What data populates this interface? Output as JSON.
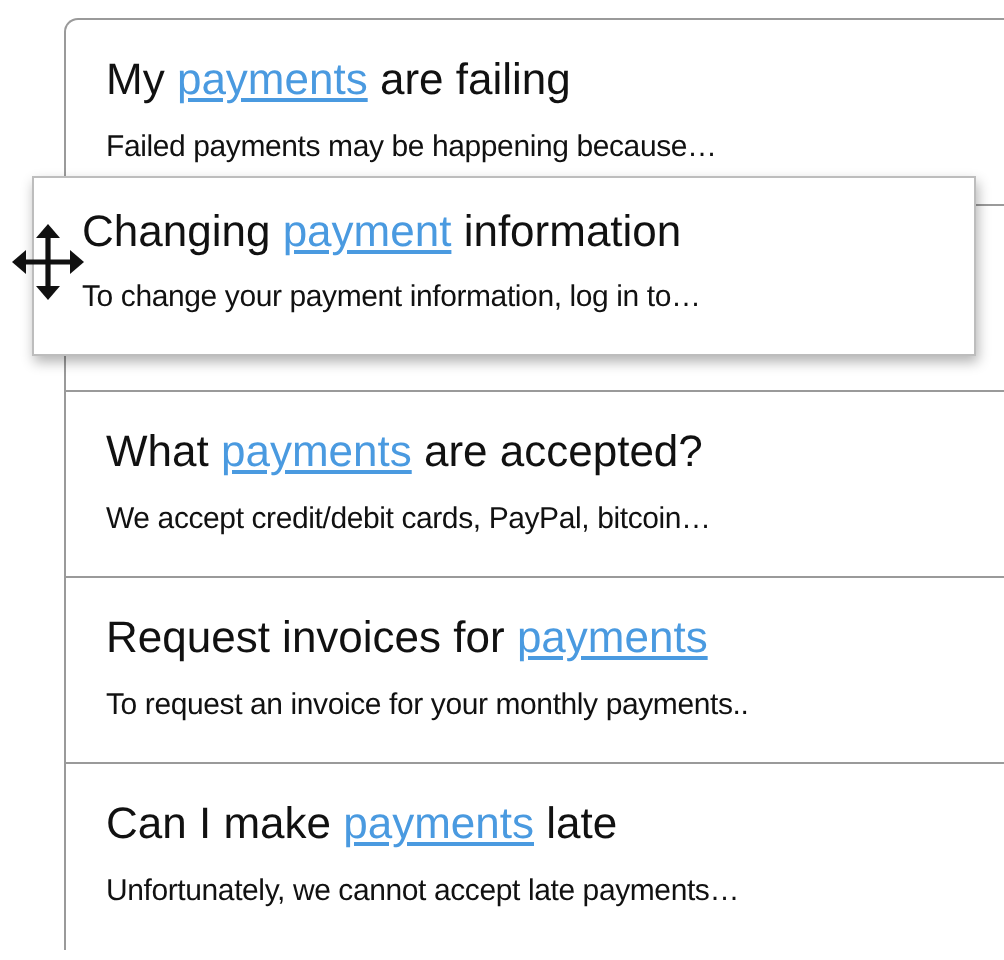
{
  "items": [
    {
      "title_start": "My ",
      "title_link": "payments",
      "title_end": " are failing",
      "summary": "Failed payments may be happening because…",
      "dragging": false
    },
    {
      "title_start": "Changing ",
      "title_link": "payment",
      "title_end": " information",
      "summary": "To change your payment information, log in to…",
      "dragging": true
    },
    {
      "title_start": "What ",
      "title_link": "payments",
      "title_end": " are accepted?",
      "summary": "We accept credit/debit cards, PayPal, bitcoin…",
      "dragging": false
    },
    {
      "title_start": "Request invoices for ",
      "title_link": "payments",
      "summary": "To request an invoice for your monthly payments..",
      "dragging": false
    },
    {
      "title_start": "Can I make ",
      "title_link": "payments",
      "title_end": " late",
      "summary": "Unfortunately, we cannot accept late payments…",
      "dragging": false
    }
  ]
}
